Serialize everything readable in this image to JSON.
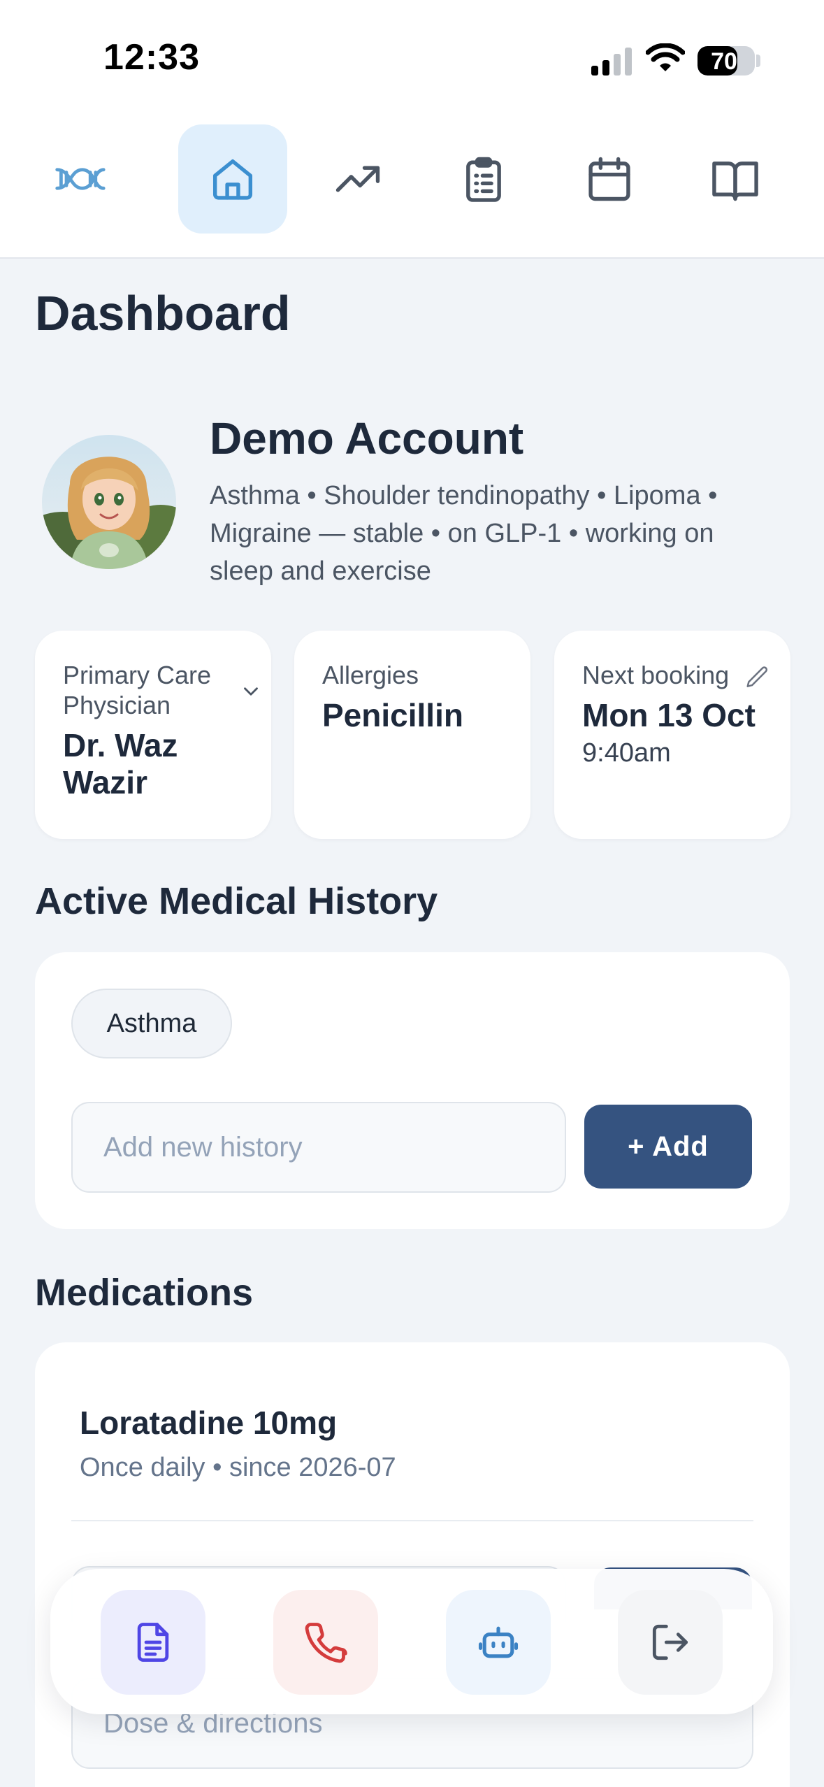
{
  "status_bar": {
    "time": "12:33",
    "battery_level": "70",
    "battery_fraction": 0.7
  },
  "nav": {
    "items": [
      {
        "name": "logo",
        "icon": "dna-logo-icon",
        "active": false
      },
      {
        "name": "home",
        "icon": "home-icon",
        "active": true
      },
      {
        "name": "trends",
        "icon": "trending-up-icon",
        "active": false
      },
      {
        "name": "records",
        "icon": "clipboard-list-icon",
        "active": false
      },
      {
        "name": "calendar",
        "icon": "calendar-icon",
        "active": false
      },
      {
        "name": "library",
        "icon": "book-open-icon",
        "active": false
      }
    ],
    "active_color": "#3b8fd0"
  },
  "page_title": "Dashboard",
  "profile": {
    "name": "Demo Account",
    "summary": "Asthma • Shoulder tendinopathy • Lipoma • Migraine — stable • on GLP-1 • working on sleep and exercise"
  },
  "cards": {
    "pcp": {
      "label": "Primary Care Physician",
      "value": "Dr. Waz Wazir"
    },
    "allergies": {
      "label": "Allergies",
      "value": "Penicillin"
    },
    "booking": {
      "label": "Next booking",
      "value": "Mon 13 Oct",
      "time": "9:40am"
    }
  },
  "history": {
    "title": "Active Medical History",
    "tags": [
      "Asthma"
    ],
    "input_placeholder": "Add new history",
    "add_label": "+ Add"
  },
  "medications": {
    "title": "Medications",
    "items": [
      {
        "name": "Loratadine 10mg",
        "detail": "Once daily • since 2026-07"
      }
    ],
    "dose_placeholder": "Dose & directions"
  },
  "bottom_actions": [
    {
      "name": "notes",
      "icon": "document-icon",
      "color": "#4f46e5",
      "bg": "#ecedfd"
    },
    {
      "name": "call",
      "icon": "phone-icon",
      "color": "#d43c3c",
      "bg": "#fcefee"
    },
    {
      "name": "assistant",
      "icon": "robot-icon",
      "color": "#3b82c4",
      "bg": "#eef5fd"
    },
    {
      "name": "logout",
      "icon": "logout-icon",
      "color": "#4b5563",
      "bg": "#f4f5f7"
    }
  ],
  "colors": {
    "primary_button": "#355380",
    "background": "#f1f4f8"
  }
}
